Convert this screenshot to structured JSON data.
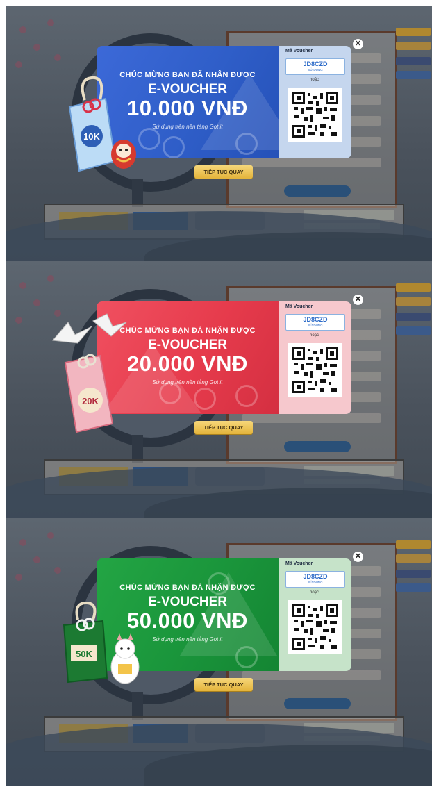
{
  "panels": [
    {
      "theme": "blue",
      "accent": "#3c69d8",
      "headline": "CHÚC MỪNG BẠN ĐÃ NHẬN ĐƯỢC",
      "type_label": "E-VOUCHER",
      "amount": "10.000 VNĐ",
      "sub": "Sử dụng trên nền tảng Got it",
      "code_label": "Mã Voucher",
      "code": "JD8CZD",
      "code_use": "SỬ DỤNG",
      "or": "hoặc",
      "cta": "TIẾP TỤC QUAY",
      "charm_label": "10K",
      "close_icon": "close-icon"
    },
    {
      "theme": "red",
      "accent": "#e63b4c",
      "headline": "CHÚC MỪNG BẠN ĐÃ NHẬN ĐƯỢC",
      "type_label": "E-VOUCHER",
      "amount": "20.000 VNĐ",
      "sub": "Sử dụng trên nền tảng Got it",
      "code_label": "Mã Voucher",
      "code": "JD8CZD",
      "code_use": "SỬ DỤNG",
      "or": "hoặc",
      "cta": "TIẾP TỤC QUAY",
      "charm_label": "20K",
      "close_icon": "close-icon"
    },
    {
      "theme": "green",
      "accent": "#1a953b",
      "headline": "CHÚC MỪNG BẠN ĐÃ NHẬN ĐƯỢC",
      "type_label": "E-VOUCHER",
      "amount": "50.000 VNĐ",
      "sub": "Sử dụng trên nền tảng Got it",
      "code_label": "Mã Voucher",
      "code": "JD8CZD",
      "code_use": "SỬ DỤNG",
      "or": "hoặc",
      "cta": "TIẾP TỤC QUAY",
      "charm_label": "50K",
      "close_icon": "close-icon"
    }
  ]
}
